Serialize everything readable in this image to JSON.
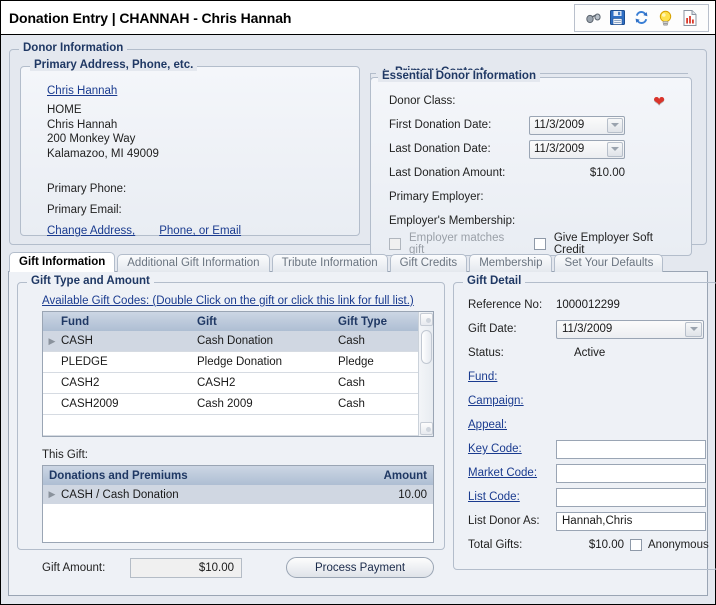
{
  "window": {
    "title": "Donation Entry | CHANNAH - Chris Hannah"
  },
  "toolbar": {
    "icons": [
      {
        "name": "binoculars-icon",
        "glyph": "⚒"
      },
      {
        "name": "save-icon",
        "glyph": "💾"
      },
      {
        "name": "refresh-icon",
        "glyph": "↻"
      },
      {
        "name": "lightbulb-icon",
        "glyph": "💡"
      },
      {
        "name": "report-icon",
        "glyph": "📄"
      }
    ]
  },
  "donor_information": {
    "legend": "Donor Information",
    "address_group": {
      "legend": "Primary Address, Phone, etc.",
      "name_link": "Chris Hannah",
      "address_type": "HOME",
      "address_name": "Chris Hannah",
      "street": "200 Monkey Way",
      "city_state_zip": "Kalamazoo, MI 49009",
      "primary_phone_label": "Primary Phone:",
      "primary_phone_value": "",
      "primary_email_label": "Primary Email:",
      "primary_email_value": "",
      "change_address_link": "Change Address,",
      "phone_email_link": "Phone, or Email"
    },
    "primary_contact": {
      "label": "Primary Contact",
      "expander": "+"
    },
    "essential_donor_information": {
      "legend": "Essential Donor Information",
      "rows": [
        {
          "label": "Donor Class:",
          "value": ""
        },
        {
          "label": "First Donation Date:",
          "value": "11/3/2009"
        },
        {
          "label": "Last Donation Date:",
          "value": "11/3/2009"
        },
        {
          "label": "Last Donation Amount:",
          "value": "$10.00"
        },
        {
          "label": "Primary Employer:",
          "value": ""
        },
        {
          "label": "Employer's Membership:",
          "value": ""
        }
      ],
      "employer_matches_gift": "Employer matches gift",
      "give_employer_soft_credit": "Give Employer Soft Credit"
    }
  },
  "tabs": [
    {
      "label": "Gift Information",
      "active": true
    },
    {
      "label": "Additional Gift Information",
      "active": false
    },
    {
      "label": "Tribute Information",
      "active": false
    },
    {
      "label": "Gift Credits",
      "active": false
    },
    {
      "label": "Membership",
      "active": false
    },
    {
      "label": "Set Your Defaults",
      "active": false
    }
  ],
  "gift_type_and_amount": {
    "legend": "Gift Type and Amount",
    "available_gift_codes_link": "Available Gift Codes: (Double Click on the gift or click this link for full list.)",
    "grid": {
      "columns": [
        "Fund",
        "Gift",
        "Gift Type"
      ],
      "rows": [
        {
          "fund": "CASH",
          "gift": "Cash Donation",
          "gift_type": "Cash",
          "selected": true
        },
        {
          "fund": "PLEDGE",
          "gift": "Pledge Donation",
          "gift_type": "Pledge",
          "selected": false
        },
        {
          "fund": "CASH2",
          "gift": "CASH2",
          "gift_type": "Cash",
          "selected": false
        },
        {
          "fund": "CASH2009",
          "gift": "Cash 2009",
          "gift_type": "Cash",
          "selected": false
        }
      ]
    },
    "this_gift_label": "This Gift:",
    "donations_grid": {
      "columns": [
        "Donations and Premiums",
        "Amount"
      ],
      "rows": [
        {
          "name": "CASH / Cash Donation",
          "amount": "10.00"
        }
      ]
    },
    "gift_amount_label": "Gift Amount:",
    "gift_amount_value": "$10.00",
    "process_payment_button": "Process Payment"
  },
  "gift_detail": {
    "legend": "Gift Detail",
    "reference_no_label": "Reference No:",
    "reference_no_value": "1000012299",
    "gift_date_label": "Gift Date:",
    "gift_date_value": "11/3/2009",
    "status_label": "Status:",
    "status_value": "Active",
    "fund_label": "Fund:",
    "fund_value": "",
    "campaign_label": "Campaign:",
    "campaign_value": "",
    "appeal_label": "Appeal:",
    "appeal_value": "",
    "key_code_label": "Key Code:",
    "key_code_value": "",
    "market_code_label": "Market Code:",
    "market_code_value": "",
    "list_code_label": "List Code:",
    "list_code_value": "",
    "list_donor_as_label": "List Donor As:",
    "list_donor_as_value": "Hannah,Chris",
    "total_gifts_label": "Total Gifts:",
    "total_gifts_value": "$10.00",
    "anonymous_label": "Anonymous"
  }
}
